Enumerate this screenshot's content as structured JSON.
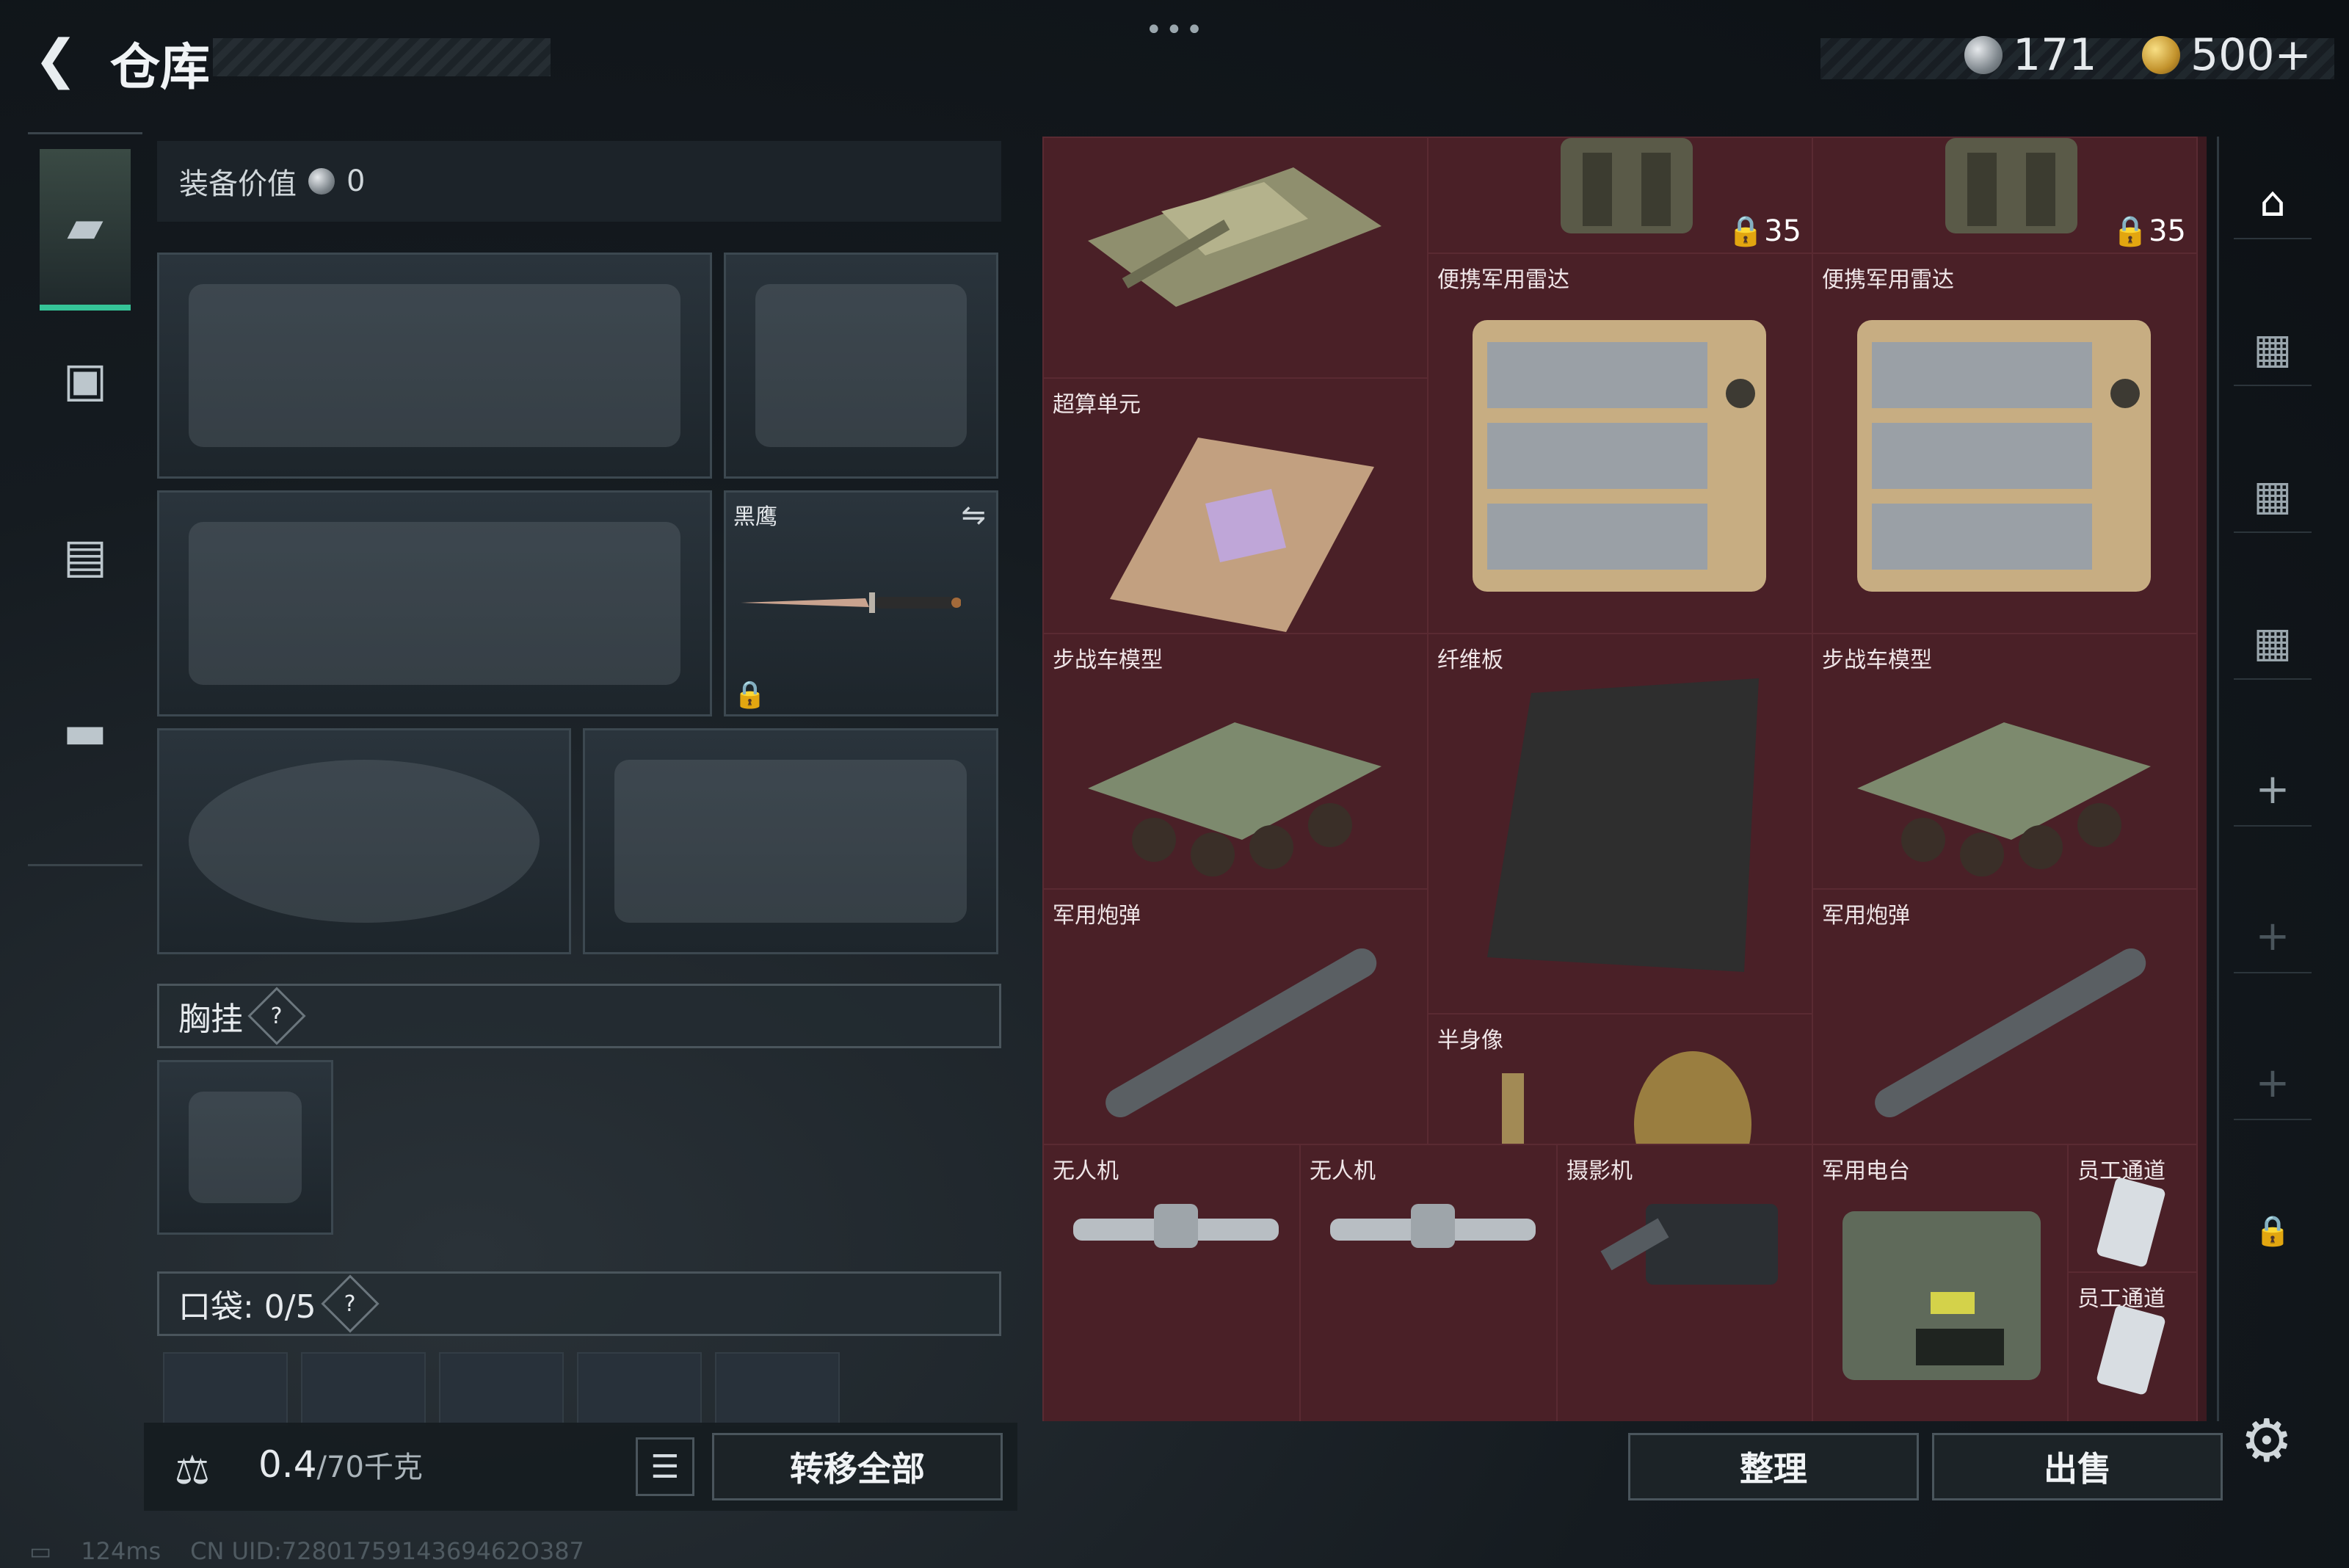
{
  "header": {
    "title": "仓库",
    "silver_amount": "171",
    "gold_amount": "500+",
    "more": "•••"
  },
  "equipment": {
    "value_label": "装备价值",
    "value": "0",
    "knife_slot_name": "黑鹰",
    "chest_label": "胸挂",
    "chest_help": "?",
    "pocket_label": "口袋: 0/5",
    "pocket_help": "?"
  },
  "bottom": {
    "weight_current": "0.4",
    "weight_max": "/70千克",
    "transfer_all": "转移全部",
    "sort": "整理",
    "sell": "出售"
  },
  "grid_items": [
    {
      "name": "",
      "count": ""
    },
    {
      "name": "",
      "count": "35"
    },
    {
      "name": "",
      "count": "35"
    },
    {
      "name": "便携军用雷达",
      "count": ""
    },
    {
      "name": "便携军用雷达",
      "count": ""
    },
    {
      "name": "超算单元",
      "count": ""
    },
    {
      "name": "纤维板",
      "count": ""
    },
    {
      "name": "步战车模型",
      "count": ""
    },
    {
      "name": "步战车模型",
      "count": ""
    },
    {
      "name": "军用炮弹",
      "count": ""
    },
    {
      "name": "军用炮弹",
      "count": ""
    },
    {
      "name": "半身像",
      "count": ""
    },
    {
      "name": "军用电台",
      "count": ""
    },
    {
      "name": "员工通道",
      "count": ""
    },
    {
      "name": "员工通道",
      "count": ""
    },
    {
      "name": "无人机",
      "count": ""
    },
    {
      "name": "无人机",
      "count": ""
    },
    {
      "name": "摄影机",
      "count": ""
    }
  ],
  "status": {
    "ping": "124ms",
    "uid": "CN UID:7280175914369462O387"
  },
  "icons": {
    "nav": [
      "pistol-icon",
      "backpack-icon",
      "clipboard-icon",
      "toolbox-icon"
    ],
    "right": [
      "safe-house-icon",
      "tier4-storage-icon",
      "tier3-storage-icon",
      "tier4-storage-icon",
      "plus-icon",
      "plus-icon",
      "plus-icon",
      "lock-icon"
    ]
  },
  "colors": {
    "accent": "#35c598",
    "grid_bg": "#4a2027",
    "gold": "#c2922c"
  }
}
